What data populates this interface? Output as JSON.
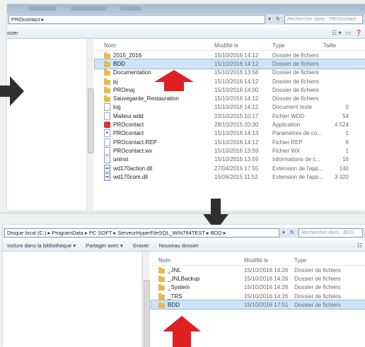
{
  "colors": {
    "red_arrow": "#e02020",
    "dark_arrow": "#303030",
    "selection": "#cfe4f7"
  },
  "window1": {
    "breadcrumb": "PROcontact ▸",
    "search_placeholder": "Rechercher dans : PROcontact",
    "toolbar_item": "ssier",
    "columns": {
      "name": "Nom",
      "date": "Modifié le",
      "type": "Type",
      "size": "Taille"
    },
    "files": [
      {
        "name": "2015_2016",
        "date": "15/10/2016 14:12",
        "type": "Dossier de fichiers",
        "size": "",
        "icon": "folder-icon"
      },
      {
        "name": "BDD",
        "date": "15/10/2016 14:12",
        "type": "Dossier de fichiers",
        "size": "",
        "icon": "folder-icon"
      },
      {
        "name": "Documentation",
        "date": "15/10/2016 13:58",
        "type": "Dossier de fichiers",
        "size": "",
        "icon": "folder-icon"
      },
      {
        "name": "pj",
        "date": "15/10/2016 14:12",
        "type": "Dossier de fichiers",
        "size": "",
        "icon": "folder-icon"
      },
      {
        "name": "PROmaj",
        "date": "15/10/2016 14:00",
        "type": "Dossier de fichiers",
        "size": "",
        "icon": "folder-icon"
      },
      {
        "name": "Sauvegarde_Restauration",
        "date": "15/10/2016 14:12",
        "type": "Dossier de fichiers",
        "size": "",
        "icon": "folder-icon"
      },
      {
        "name": "log",
        "date": "15/10/2016 14:12",
        "type": "Document texte",
        "size": "0",
        "icon": "file-icon"
      },
      {
        "name": "Maileur.wdd",
        "date": "03/10/2015 10:17",
        "type": "Fichier WDD",
        "size": "54",
        "icon": "file-icon"
      },
      {
        "name": "PROcontact",
        "date": "28/10/2015 20:30",
        "type": "Application",
        "size": "4 524",
        "icon": "app-icon"
      },
      {
        "name": "PROcontact",
        "date": "15/10/2016 14:13",
        "type": "Paramètres de co...",
        "size": "1",
        "icon": "config-icon"
      },
      {
        "name": "PROcontact.REP",
        "date": "15/10/2016 14:12",
        "type": "Fichier REP",
        "size": "6",
        "icon": "file-icon"
      },
      {
        "name": "PROcontact.wx",
        "date": "15/10/2016 13:59",
        "type": "Fichier WX",
        "size": "1",
        "icon": "file-icon"
      },
      {
        "name": "uninst",
        "date": "15/10/2016 13:59",
        "type": "Informations de c...",
        "size": "16",
        "icon": "info-icon"
      },
      {
        "name": "wd170action.dll",
        "date": "27/04/2015 17:55",
        "type": "Extension de l'app...",
        "size": "140",
        "icon": "dll-icon"
      },
      {
        "name": "wd170com.dll",
        "date": "15/06/2015 11:52",
        "type": "Extension de l'app...",
        "size": "3 320",
        "icon": "dll-icon"
      }
    ]
  },
  "window2": {
    "breadcrumb": "Disque local (C:) ▸ ProgramData ▸ PC SOFT ▸ ServeurHyperFileSQL_WIN764TEST ▸ BDD ▸",
    "search_placeholder": "Rechercher dans : BDD",
    "toolbar": {
      "include": "Inclure dans la bibliothèque ▾",
      "share": "Partager avec ▾",
      "burn": "Graver",
      "new_folder": "Nouveau dossier"
    },
    "columns": {
      "name": "Nom",
      "date": "Modifié le",
      "type": "Type"
    },
    "files": [
      {
        "name": "_JNL",
        "date": "15/10/2016 14:26",
        "type": "Dossier de fichiers"
      },
      {
        "name": "_JNLBackup",
        "date": "15/10/2016 14:26",
        "type": "Dossier de fichiers"
      },
      {
        "name": "_System",
        "date": "15/10/2016 14:26",
        "type": "Dossier de fichiers"
      },
      {
        "name": "_TRS",
        "date": "15/10/2016 14:26",
        "type": "Dossier de fichiers"
      },
      {
        "name": "BDD",
        "date": "15/10/2016 17:51",
        "type": "Dossier de fichiers"
      }
    ]
  }
}
